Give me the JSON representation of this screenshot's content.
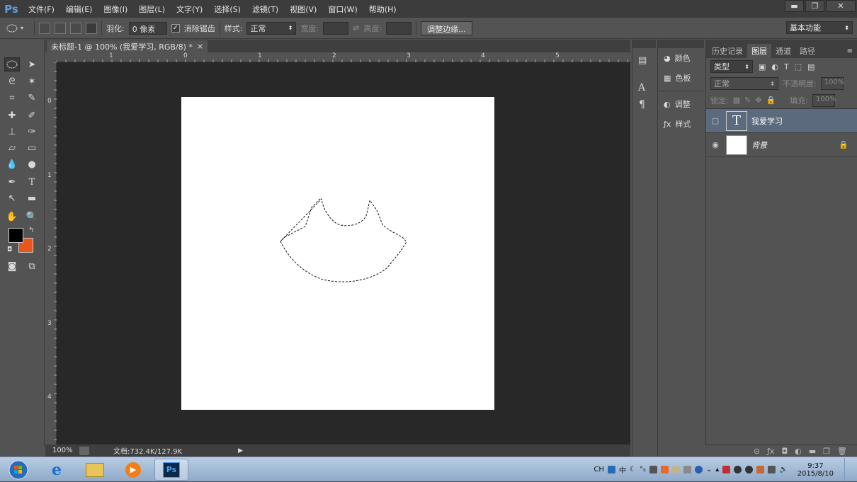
{
  "app": {
    "logo": "Ps",
    "name": "Adobe Photoshop CS6"
  },
  "menu": [
    "文件(F)",
    "编辑(E)",
    "图像(I)",
    "图层(L)",
    "文字(Y)",
    "选择(S)",
    "滤镜(T)",
    "视图(V)",
    "窗口(W)",
    "帮助(H)"
  ],
  "window_controls": {
    "minimize": "▬",
    "restore": "❐",
    "close": "✕"
  },
  "options": {
    "feather_label": "羽化:",
    "feather_value": "0 像素",
    "antialias_label": "消除锯齿",
    "antialias_checked": "✓",
    "style_label": "样式:",
    "style_value": "正常",
    "width_label": "宽度:",
    "height_label": "高度:",
    "refine_edge": "调整边缘...",
    "workspace": "基本功能"
  },
  "document": {
    "tab_title": "未标题-1 @ 100% (我爱学习, RGB/8) *",
    "tab_close": "×",
    "ruler_h": [
      "1",
      "0",
      "1",
      "2",
      "3",
      "4",
      "5"
    ],
    "ruler_v": [
      "0",
      "1",
      "2",
      "3",
      "4"
    ]
  },
  "status": {
    "zoom": "100%",
    "doc_info": "文档:732.4K/127.9K"
  },
  "adjust_panel": {
    "items": [
      "颜色",
      "色板",
      "调整",
      "样式"
    ]
  },
  "layers_panel": {
    "tabs": [
      "历史记录",
      "图层",
      "通道",
      "路径"
    ],
    "active_tab": "图层",
    "filter_kind": "类型",
    "blend_mode": "正常",
    "opacity_label": "不透明度:",
    "opacity_value": "100%",
    "lock_label": "锁定:",
    "fill_label": "填充:",
    "fill_value": "100%",
    "layers": [
      {
        "name": "我爱学习",
        "type": "text",
        "thumb": "T",
        "selected": true
      },
      {
        "name": "背景",
        "type": "background",
        "locked": true,
        "selected": false
      }
    ]
  },
  "colors": {
    "foreground": "#000000",
    "background": "#e8561c",
    "pasteboard": "#282828",
    "canvas": "#ffffff"
  },
  "taskbar": {
    "apps": [
      "start-orb",
      "internet-explorer",
      "file-explorer",
      "media-player",
      "photoshop"
    ],
    "input_indicator": "CH",
    "time": "9:37",
    "date": "2015/8/10"
  }
}
